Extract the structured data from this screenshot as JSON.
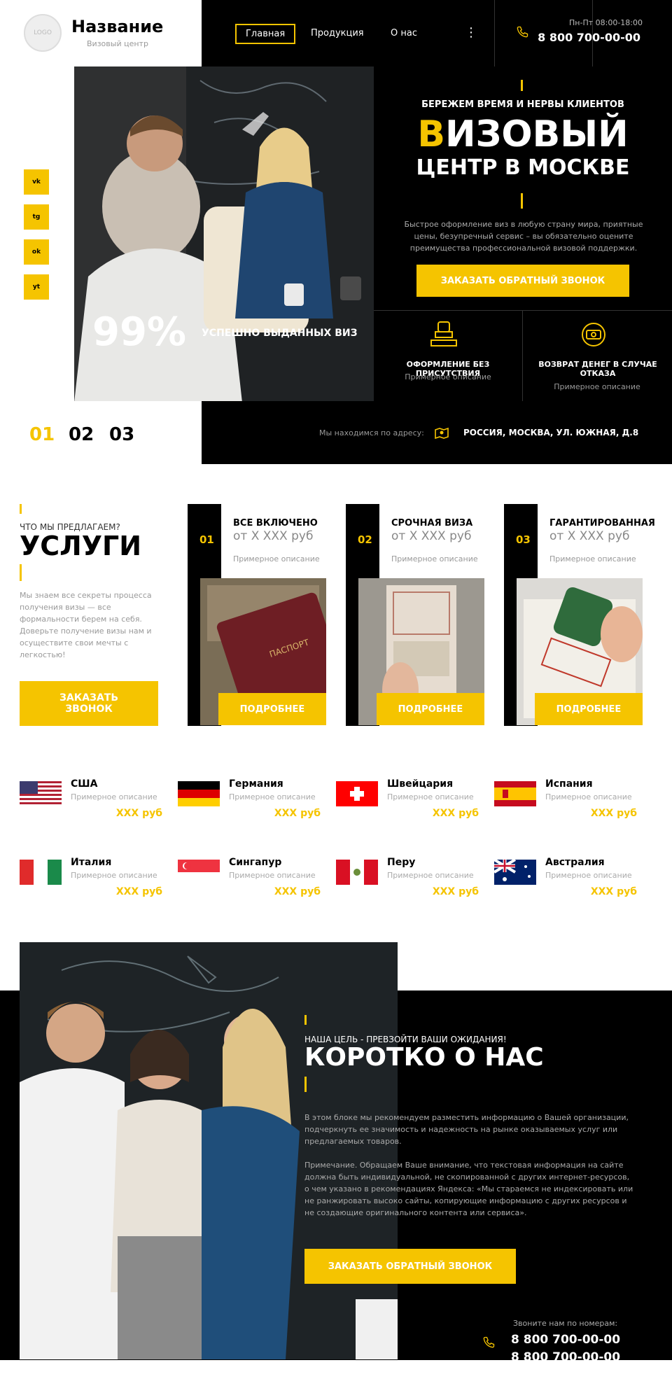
{
  "header": {
    "logo": "LOGO",
    "brand": "Название",
    "brand_sub": "Визовый центр",
    "nav": [
      "Главная",
      "Продукция",
      "О нас"
    ],
    "dots": "⋮",
    "hours": "Пн-Пт 08:00-18:00",
    "phone": "8 800 700-00-00"
  },
  "social": [
    "vk",
    "tg",
    "ok",
    "yt"
  ],
  "hero": {
    "tagline": "БЕРЕЖЕМ ВРЕМЯ И НЕРВЫ КЛИЕНТОВ",
    "title_b": "В",
    "title_rest": "ИЗОВЫЙ",
    "title_line2": "ЦЕНТР В МОСКВЕ",
    "desc": "Быстрое оформление виз в любую страну мира, приятные цены, безупречный сервис – вы обязательно оцените преимущества профессиональной визовой поддержки.",
    "cta": "ЗАКАЗАТЬ ОБРАТНЫЙ ЗВОНОК",
    "stat_value": "99%",
    "stat_label": "УСПЕШНО ВЫДАННЫХ ВИЗ",
    "features": [
      {
        "title": "ОФОРМЛЕНИЕ БЕЗ ПРИСУТСТВИЯ",
        "desc": "Примерное описание"
      },
      {
        "title": "ВОЗВРАТ ДЕНЕГ В СЛУЧАЕ ОТКАЗА",
        "desc": "Примерное описание"
      }
    ]
  },
  "slides": [
    "01",
    "02",
    "03"
  ],
  "address": {
    "label": "Мы находимся по адресу:",
    "value": "РОССИЯ, МОСКВА, УЛ. ЮЖНАЯ, Д.8"
  },
  "services": {
    "subtitle": "ЧТО МЫ ПРЕДЛАГАЕМ?",
    "title": "УСЛУГИ",
    "desc": "Мы знаем все секреты процесса получения визы — все формальности берем на себя. Доверьте получение визы нам и осуществите свои мечты с легкостью!",
    "cta_line1": "ЗАКАЗАТЬ",
    "cta_line2": "ЗВОНОК",
    "cards": [
      {
        "num": "01",
        "title": "ВСЕ ВКЛЮЧЕНО",
        "price": "от Х ХХХ руб",
        "desc": "Примерное описание",
        "btn": "ПОДРОБНЕЕ"
      },
      {
        "num": "02",
        "title": "СРОЧНАЯ ВИЗА",
        "price": "от Х ХХХ руб",
        "desc": "Примерное описание",
        "btn": "ПОДРОБНЕЕ"
      },
      {
        "num": "03",
        "title": "ГАРАНТИРОВАННАЯ",
        "price": "от Х ХХХ руб",
        "desc": "Примерное описание",
        "btn": "ПОДРОБНЕЕ"
      }
    ]
  },
  "countries": [
    {
      "name": "США",
      "desc": "Примерное описание",
      "price": "XXX руб"
    },
    {
      "name": "Германия",
      "desc": "Примерное описание",
      "price": "XXX руб"
    },
    {
      "name": "Швейцария",
      "desc": "Примерное описание",
      "price": "XXX руб"
    },
    {
      "name": "Испания",
      "desc": "Примерное описание",
      "price": "XXX руб"
    },
    {
      "name": "Италия",
      "desc": "Примерное описание",
      "price": "XXX руб"
    },
    {
      "name": "Сингапур",
      "desc": "Примерное описание",
      "price": "XXX руб"
    },
    {
      "name": "Перу",
      "desc": "Примерное описание",
      "price": "XXX руб"
    },
    {
      "name": "Австралия",
      "desc": "Примерное описание",
      "price": "XXX руб"
    }
  ],
  "about": {
    "subtitle": "НАША ЦЕЛЬ - ПРЕВЗОЙТИ ВАШИ ОЖИДАНИЯ!",
    "title": "КОРОТКО О НАС",
    "p1": "В этом блоке мы рекомендуем разместить информацию о Вашей организации, подчеркнуть ее значимость и надежность на рынке оказываемых услуг или предлагаемых товаров.",
    "p2": "Примечание. Обращаем Ваше внимание, что текстовая информация на сайте должна быть индивидуальной, не скопированной с других интернет-ресурсов, о чем указано в рекомендациях Яндекса: «Мы стараемся не индексировать или не ранжировать высоко сайты, копирующие информацию с других ресурсов и не создающие оригинального контента или сервиса».",
    "cta": "ЗАКАЗАТЬ ОБРАТНЫЙ ЗВОНОК",
    "call_label": "Звоните нам по номерам:",
    "phone1": "8 800 700-00-00",
    "phone2": "8 800 700-00-00"
  },
  "colors": {
    "accent": "#f5c400",
    "dark": "#000000"
  }
}
